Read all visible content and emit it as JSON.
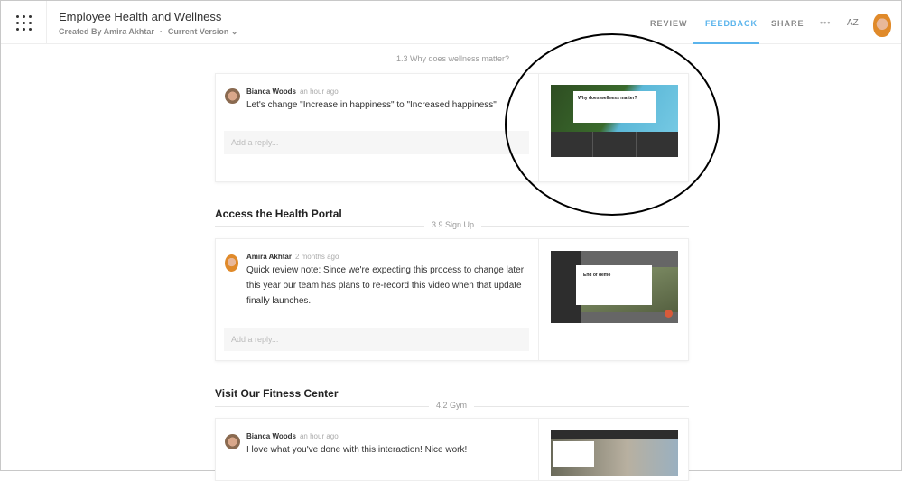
{
  "header": {
    "title": "Employee Health and Wellness",
    "created_by": "Created By Amira Akhtar",
    "separator": "·",
    "version": "Current Version ⌄",
    "tabs": [
      {
        "label": "REVIEW"
      },
      {
        "label": "FEEDBACK"
      },
      {
        "label": "SHARE"
      }
    ],
    "more": "•••",
    "sort": "AZ"
  },
  "sections": [
    {
      "heading": "",
      "slide": "1.3 Why does wellness matter?",
      "comment": {
        "author": "Bianca Woods",
        "time": "an hour ago",
        "text": "Let's change \"Increase in happiness\" to \"Increased happiness\""
      },
      "reply_placeholder": "Add a reply...",
      "thumb_title": "Why does wellness matter?"
    },
    {
      "heading": "Access the Health Portal",
      "slide": "3.9 Sign Up",
      "comment": {
        "author": "Amira Akhtar",
        "time": "2 months ago",
        "text": "Quick review note: Since we're expecting this process to change later this year our team has plans to re-record this video when that update finally launches."
      },
      "reply_placeholder": "Add a reply...",
      "thumb_title": "End of demo"
    },
    {
      "heading": "Visit Our Fitness Center",
      "slide": "4.2 Gym",
      "comment": {
        "author": "Bianca Woods",
        "time": "an hour ago",
        "text": "I love what you've done with this interaction! Nice work!"
      }
    }
  ],
  "colors": {
    "accent": "#5ab4ec"
  }
}
